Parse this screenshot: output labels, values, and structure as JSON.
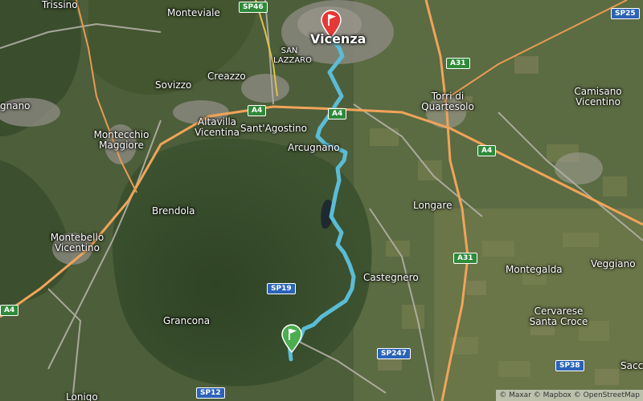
{
  "places": [
    {
      "text": "Trissino"
    },
    {
      "text": "Monteviale"
    },
    {
      "text": "Vicenza"
    },
    {
      "text": "SAN LAZZARO"
    },
    {
      "text": "Sovizzo"
    },
    {
      "text": "Creazzo"
    },
    {
      "text": "gnano"
    },
    {
      "text": "Torri di Quartesolo"
    },
    {
      "text": "Camisano Vicentino"
    },
    {
      "text": "Montecchio Maggiore"
    },
    {
      "text": "Altavilla Vicentina"
    },
    {
      "text": "Sant'Agostino"
    },
    {
      "text": "Arcugnano"
    },
    {
      "text": "Brendola"
    },
    {
      "text": "Longare"
    },
    {
      "text": "Montebello Vicentino"
    },
    {
      "text": "Castegnero"
    },
    {
      "text": "Montegalda"
    },
    {
      "text": "Veggiano"
    },
    {
      "text": "Grancona"
    },
    {
      "text": "Cervarese Santa Croce"
    },
    {
      "text": "Lonigo"
    },
    {
      "text": "Saccc"
    }
  ],
  "shields": [
    {
      "text": "SP46"
    },
    {
      "text": "SP25"
    },
    {
      "text": "A31"
    },
    {
      "text": "A4"
    },
    {
      "text": "A4"
    },
    {
      "text": "A4"
    },
    {
      "text": "A4"
    },
    {
      "text": "A31"
    },
    {
      "text": "SP19"
    },
    {
      "text": "SP247"
    },
    {
      "text": "SP38"
    },
    {
      "text": "SP12"
    }
  ],
  "colors": {
    "route": "#5bbcd6",
    "start_marker": "#4cae4f",
    "end_marker": "#e53935",
    "motorway": "#f0a45a"
  },
  "markers": {
    "start": "flag-icon",
    "end": "flag-icon"
  },
  "attribution": "© Maxar © Mapbox © OpenStreetMap"
}
